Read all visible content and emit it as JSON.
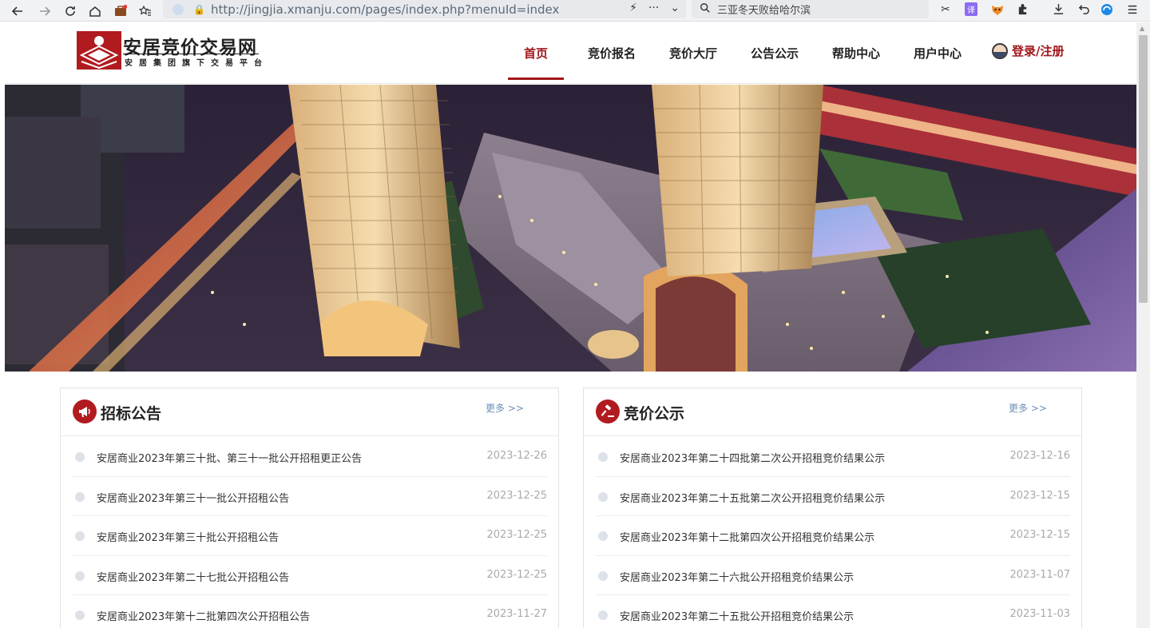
{
  "browser": {
    "url": "http://jingjia.xmanju.com/pages/index.php?menuId=index",
    "search_text": "三亚冬天败给哈尔滨",
    "ext_translate": "译"
  },
  "site": {
    "logo_title": "安居竞价交易网",
    "logo_subtitle": "安居集团旗下交易平台"
  },
  "nav": {
    "items": [
      {
        "label": "首页",
        "active": true
      },
      {
        "label": "竞价报名",
        "active": false
      },
      {
        "label": "竞价大厅",
        "active": false
      },
      {
        "label": "公告公示",
        "active": false
      },
      {
        "label": "帮助中心",
        "active": false
      },
      {
        "label": "用户中心",
        "active": false
      }
    ],
    "login_label": "登录/注册"
  },
  "panels": {
    "tender": {
      "title": "招标公告",
      "more": "更多 >>",
      "items": [
        {
          "title": "安居商业2023年第三十批、第三十一批公开招租更正公告",
          "date": "2023-12-26"
        },
        {
          "title": "安居商业2023年第三十一批公开招租公告",
          "date": "2023-12-25"
        },
        {
          "title": "安居商业2023年第三十批公开招租公告",
          "date": "2023-12-25"
        },
        {
          "title": "安居商业2023年第二十七批公开招租公告",
          "date": "2023-12-25"
        },
        {
          "title": "安居商业2023年第十二批第四次公开招租公告",
          "date": "2023-11-27"
        }
      ]
    },
    "result": {
      "title": "竞价公示",
      "more": "更多 >>",
      "items": [
        {
          "title": "安居商业2023年第二十四批第二次公开招租竞价结果公示",
          "date": "2023-12-16"
        },
        {
          "title": "安居商业2023年第二十五批第二次公开招租竞价结果公示",
          "date": "2023-12-15"
        },
        {
          "title": "安居商业2023年第十二批第四次公开招租竞价结果公示",
          "date": "2023-12-15"
        },
        {
          "title": "安居商业2023年第二十六批公开招租竞价结果公示",
          "date": "2023-11-07"
        },
        {
          "title": "安居商业2023年第二十五批公开招租竞价结果公示",
          "date": "2023-11-03"
        }
      ]
    }
  },
  "colors": {
    "brand_red": "#a1161b",
    "more_link": "#6b8fb8"
  }
}
